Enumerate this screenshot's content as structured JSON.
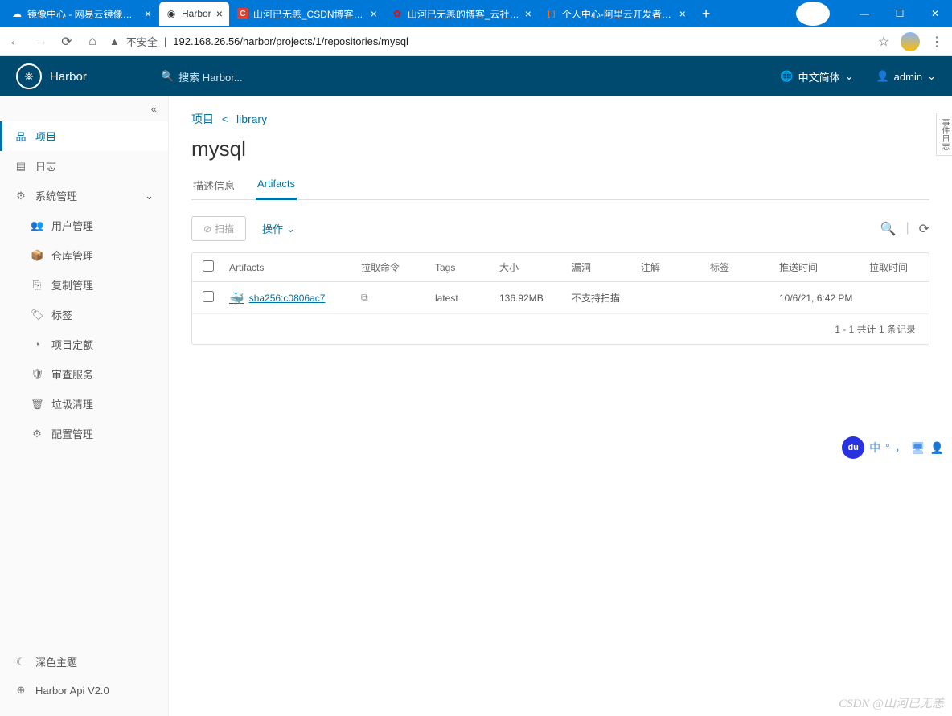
{
  "browser": {
    "tabs": [
      {
        "title": "镜像中心 - 网易云镜像中心",
        "active": false
      },
      {
        "title": "Harbor",
        "active": true
      },
      {
        "title": "山河已无恙_CSDN博客-Java",
        "active": false,
        "badge": "C",
        "badgeColor": "#e03c31"
      },
      {
        "title": "山河已无恙的博客_云社区-华",
        "active": false
      },
      {
        "title": "个人中心-阿里云开发者社区",
        "active": false
      }
    ],
    "insecure_label": "不安全",
    "url": "192.168.26.56/harbor/projects/1/repositories/mysql"
  },
  "header": {
    "app_name": "Harbor",
    "search_placeholder": "搜索 Harbor...",
    "lang_label": "中文简体",
    "user_label": "admin"
  },
  "sidebar": {
    "items": [
      "项目",
      "日志"
    ],
    "admin_label": "系统管理",
    "admin_items": [
      "用户管理",
      "仓库管理",
      "复制管理",
      "标签",
      "项目定额",
      "审查服务",
      "垃圾清理",
      "配置管理"
    ],
    "bottom": [
      "深色主题",
      "Harbor Api V2.0"
    ]
  },
  "main": {
    "breadcrumb": {
      "root": "项目",
      "parent": "library"
    },
    "title": "mysql",
    "tabs": [
      "描述信息",
      "Artifacts"
    ],
    "active_tab": 1,
    "toolbar": {
      "scan": "扫描",
      "actions": "操作"
    },
    "table": {
      "headers": [
        "Artifacts",
        "拉取命令",
        "Tags",
        "大小",
        "漏洞",
        "注解",
        "标签",
        "推送时间",
        "拉取时间"
      ],
      "rows": [
        {
          "artifact": "sha256:c0806ac7",
          "tags": "latest",
          "size": "136.92MB",
          "vuln": "不支持扫描",
          "push": "10/6/21, 6:42 PM"
        }
      ],
      "footer": "1 - 1 共计 1 条记录"
    }
  },
  "side_handle": "事件日志",
  "watermark": "CSDN @山河已无恙"
}
